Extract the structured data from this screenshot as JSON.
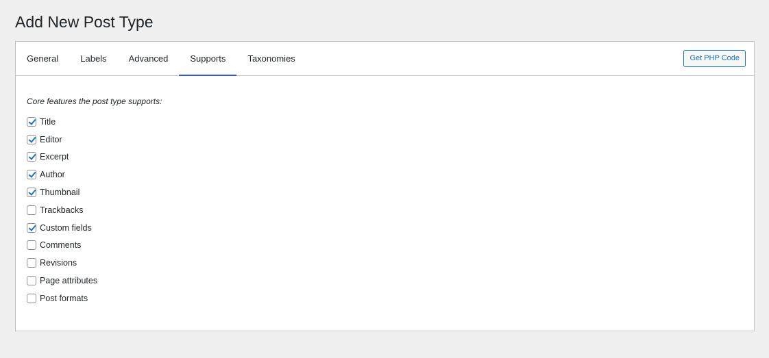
{
  "page": {
    "title": "Add New Post Type"
  },
  "tabs": [
    {
      "label": "General",
      "active": false
    },
    {
      "label": "Labels",
      "active": false
    },
    {
      "label": "Advanced",
      "active": false
    },
    {
      "label": "Supports",
      "active": true
    },
    {
      "label": "Taxonomies",
      "active": false
    }
  ],
  "toolbar": {
    "php_button_label": "Get PHP Code"
  },
  "supports": {
    "heading": "Core features the post type supports:",
    "features": [
      {
        "label": "Title",
        "checked": true
      },
      {
        "label": "Editor",
        "checked": true
      },
      {
        "label": "Excerpt",
        "checked": true
      },
      {
        "label": "Author",
        "checked": true
      },
      {
        "label": "Thumbnail",
        "checked": true
      },
      {
        "label": "Trackbacks",
        "checked": false
      },
      {
        "label": "Custom fields",
        "checked": true
      },
      {
        "label": "Comments",
        "checked": false
      },
      {
        "label": "Revisions",
        "checked": false
      },
      {
        "label": "Page attributes",
        "checked": false
      },
      {
        "label": "Post formats",
        "checked": false
      }
    ]
  },
  "colors": {
    "accent": "#3858e9",
    "link": "#2271b1",
    "background": "#f0f0f1",
    "border": "#c3c4c7"
  }
}
